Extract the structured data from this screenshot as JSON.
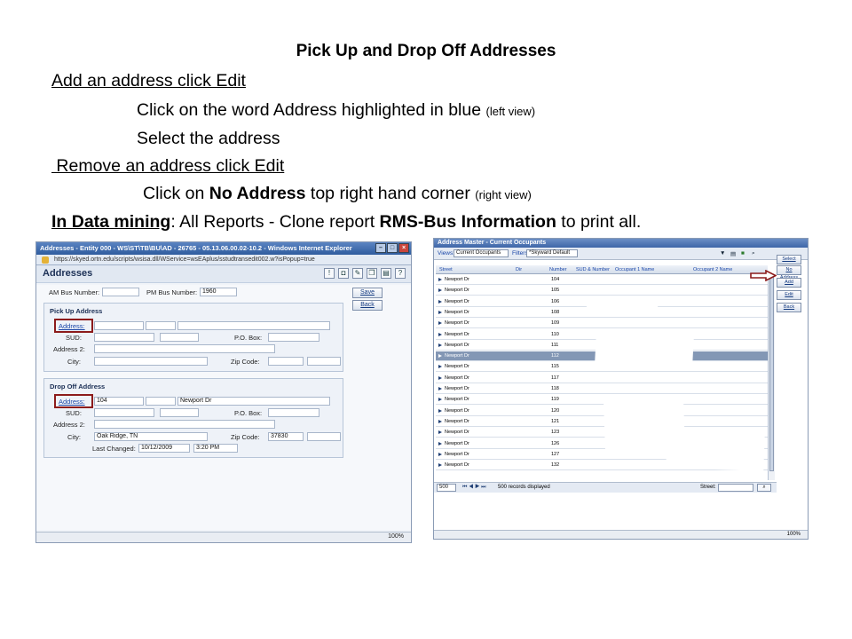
{
  "slide": {
    "title": "Pick Up and Drop Off Addresses",
    "line1": "Add an address click Edit",
    "line2_main": "Click on the word Address highlighted in blue",
    "line2_note": "(left view)",
    "line3": "Select the address",
    "line4": " Remove an address click Edit",
    "line5_pre": "Click on ",
    "line5_bold": "No Address",
    "line5_post": " top right hand corner",
    "line5_note": "(right view)",
    "line6_u": "In Data mining",
    "line6_mid": ": All Reports - Clone report ",
    "line6_bold": "RMS-Bus Information",
    "line6_post": " to print all."
  },
  "left_view": {
    "window_title": "Addresses - Entity 000 - WS\\ST\\TB\\BU\\AD - 26765 - 05.13.06.00.02-10.2 - Windows Internet Explorer",
    "url": "https://skyed.ortn.edu/scripts/wsisa.dll/WService=wsEAplus/sstudtransedit002.w?isPopup=true",
    "panel_title": "Addresses",
    "am_bus_label": "AM Bus Number:",
    "am_bus_value": "",
    "pm_bus_label": "PM Bus Number:",
    "pm_bus_value": "1960",
    "save_label": "Save",
    "back_label": "Back",
    "pickup": {
      "title": "Pick Up Address",
      "address_label": "Address:",
      "sud_label": "SUD:",
      "pobox_label": "P.O. Box:",
      "address2_label": "Address 2:",
      "city_label": "City:",
      "zip_label": "Zip Code:"
    },
    "dropoff": {
      "title": "Drop Off Address",
      "address_label": "Address:",
      "number": "104",
      "street": "Newport Dr",
      "sud_label": "SUD:",
      "pobox_label": "P.O. Box:",
      "address2_label": "Address 2:",
      "city_label": "City:",
      "city_value": "Oak Ridge, TN",
      "zip_label": "Zip Code:",
      "zip_value": "37830",
      "changed_label": "Last Changed:",
      "changed_date": "10/12/2009",
      "changed_time": "3:20 PM"
    },
    "zoom": "100%"
  },
  "right_view": {
    "title": "Address Master - Current Occupants",
    "views_label": "Views:",
    "views_value": "Current Occupants",
    "filters_label": "Filters:",
    "filters_value": "*Skyward Default",
    "columns": [
      "Street",
      "Dir",
      "Number",
      "SUD & Number",
      "Occupant 1 Name",
      "Occupant 2 Name"
    ],
    "rows": [
      {
        "street": "Newport Dr",
        "number": "104"
      },
      {
        "street": "Newport Dr",
        "number": "105"
      },
      {
        "street": "Newport Dr",
        "number": "106"
      },
      {
        "street": "Newport Dr",
        "number": "108"
      },
      {
        "street": "Newport Dr",
        "number": "109"
      },
      {
        "street": "Newport Dr",
        "number": "110"
      },
      {
        "street": "Newport Dr",
        "number": "111"
      },
      {
        "street": "Newport Dr",
        "number": "112"
      },
      {
        "street": "Newport Dr",
        "number": "115"
      },
      {
        "street": "Newport Dr",
        "number": "117"
      },
      {
        "street": "Newport Dr",
        "number": "118"
      },
      {
        "street": "Newport Dr",
        "number": "119"
      },
      {
        "street": "Newport Dr",
        "number": "120"
      },
      {
        "street": "Newport Dr",
        "number": "121"
      },
      {
        "street": "Newport Dr",
        "number": "123"
      },
      {
        "street": "Newport Dr",
        "number": "126"
      },
      {
        "street": "Newport Dr",
        "number": "127"
      },
      {
        "street": "Newport Dr",
        "number": "132"
      }
    ],
    "selected_row": 7,
    "buttons": [
      "Select",
      "No Address",
      "Add",
      "Edit",
      "Back"
    ],
    "page_size": "500",
    "records_text": "500 records displayed",
    "street_label": "Street:",
    "zoom": "100%"
  },
  "colors": {
    "highlight_box": "#8c1b1b",
    "selected_row": "#8397b5",
    "title_bar": "#2f5c9e"
  }
}
